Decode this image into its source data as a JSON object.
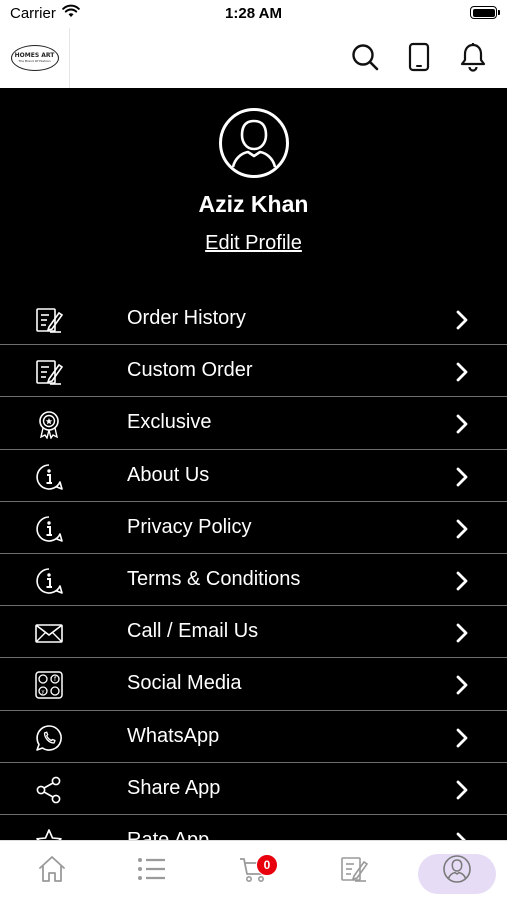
{
  "status_bar": {
    "carrier": "Carrier",
    "time": "1:28 AM"
  },
  "header": {
    "logo_text_top": "HOMES ART",
    "logo_text_bottom": "The Brand Of Fashion",
    "icons": [
      "search-icon",
      "phone-icon",
      "bell-icon"
    ]
  },
  "profile": {
    "name": "Aziz Khan",
    "edit_label": "Edit Profile"
  },
  "menu": {
    "items": [
      {
        "label": "Order History",
        "icon": "order-list-icon"
      },
      {
        "label": "Custom Order",
        "icon": "custom-order-icon"
      },
      {
        "label": "Exclusive",
        "icon": "badge-icon"
      },
      {
        "label": "About Us",
        "icon": "info-icon"
      },
      {
        "label": "Privacy Policy",
        "icon": "info-icon"
      },
      {
        "label": "Terms & Conditions",
        "icon": "info-icon"
      },
      {
        "label": "Call / Email Us",
        "icon": "envelope-icon"
      },
      {
        "label": "Social Media",
        "icon": "social-media-icon"
      },
      {
        "label": "WhatsApp",
        "icon": "whatsapp-icon"
      },
      {
        "label": "Share App",
        "icon": "share-icon"
      },
      {
        "label": "Rate App",
        "icon": "star-icon"
      }
    ]
  },
  "tab_bar": {
    "tabs": [
      "home-tab",
      "categories-tab",
      "cart-tab",
      "orders-tab",
      "profile-tab"
    ],
    "active": "profile-tab",
    "cart_count": "0",
    "active_color": "#e6dcf5",
    "badge_color": "#e8000c"
  }
}
